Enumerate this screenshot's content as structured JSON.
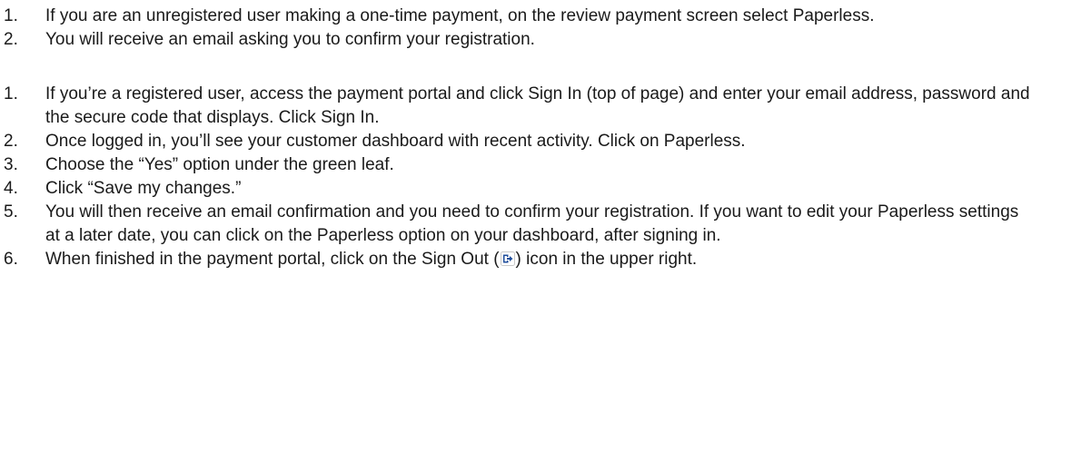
{
  "lists": [
    {
      "items": [
        {
          "num": "1.",
          "text": "If you are an unregistered user making a one-time payment, on the review payment screen select Paperless."
        },
        {
          "num": "2.",
          "text": "You will receive an email asking you to confirm your registration."
        }
      ]
    },
    {
      "items": [
        {
          "num": "1.",
          "text": "If you’re a registered user, access the payment portal and click Sign In (top of page) and enter your email address, password and the secure code that displays. Click Sign In."
        },
        {
          "num": "2.",
          "text": "Once logged in, you’ll see your customer dashboard with recent activity. Click on Paperless."
        },
        {
          "num": "3.",
          "text": "Choose the “Yes” option under the green leaf."
        },
        {
          "num": "4.",
          "text": "Click “Save my changes.”"
        },
        {
          "num": "5.",
          "text": "You will then receive an email confirmation and you need to confirm your registration. If you want to edit your Paperless settings at a later date, you can click on the Paperless option on your dashboard, after signing in."
        }
      ]
    }
  ],
  "last_item": {
    "num": "6.",
    "text_before": "When finished in the payment portal, click on the Sign Out (",
    "icon": "sign-out-icon",
    "text_after": ") icon in the upper right."
  }
}
